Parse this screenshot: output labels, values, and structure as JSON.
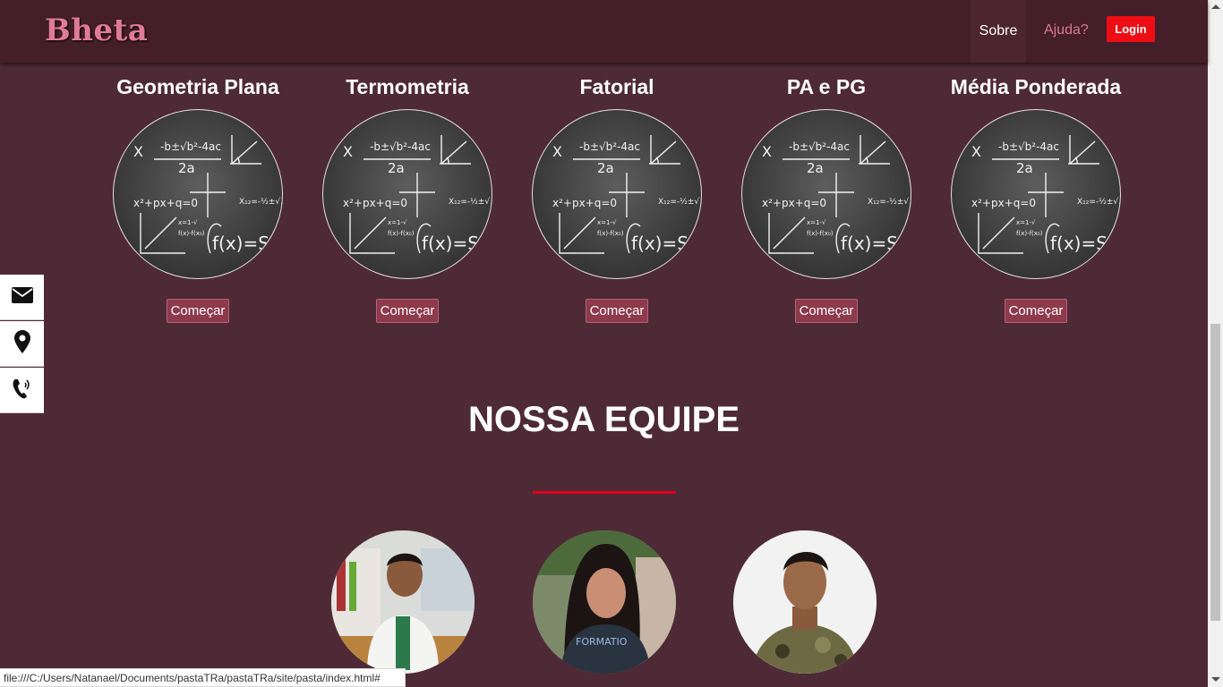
{
  "navbar": {
    "brand": "Bheta",
    "links": [
      {
        "label": "Sobre"
      },
      {
        "label": "Ajuda?"
      }
    ],
    "login_label": "Login"
  },
  "courses": [
    {
      "title": "Geometria Plana",
      "button": "Começar"
    },
    {
      "title": "Termometria",
      "button": "Começar"
    },
    {
      "title": "Fatorial",
      "button": "Começar"
    },
    {
      "title": "PA e PG",
      "button": "Começar"
    },
    {
      "title": "Média Ponderada",
      "button": "Começar"
    }
  ],
  "side_contacts": [
    {
      "icon": "envelope-icon"
    },
    {
      "icon": "map-marker-icon"
    },
    {
      "icon": "phone-icon"
    }
  ],
  "team": {
    "title": "NOSSA EQUIPE",
    "members": [
      {
        "photo": "team-member-photo"
      },
      {
        "photo": "team-member-photo"
      },
      {
        "photo": "team-member-photo"
      }
    ]
  },
  "colors": {
    "background": "#4e2a36",
    "navbar": "#441e29",
    "brand": "#e07a9c",
    "login": "#ee0d14",
    "button": "#8c3a4c",
    "accent_line": "#e3001b"
  },
  "status_bar": "file:///C:/Users/Natanael/Documents/pastaTRa/pastaTRa/site/pasta/index.html#"
}
